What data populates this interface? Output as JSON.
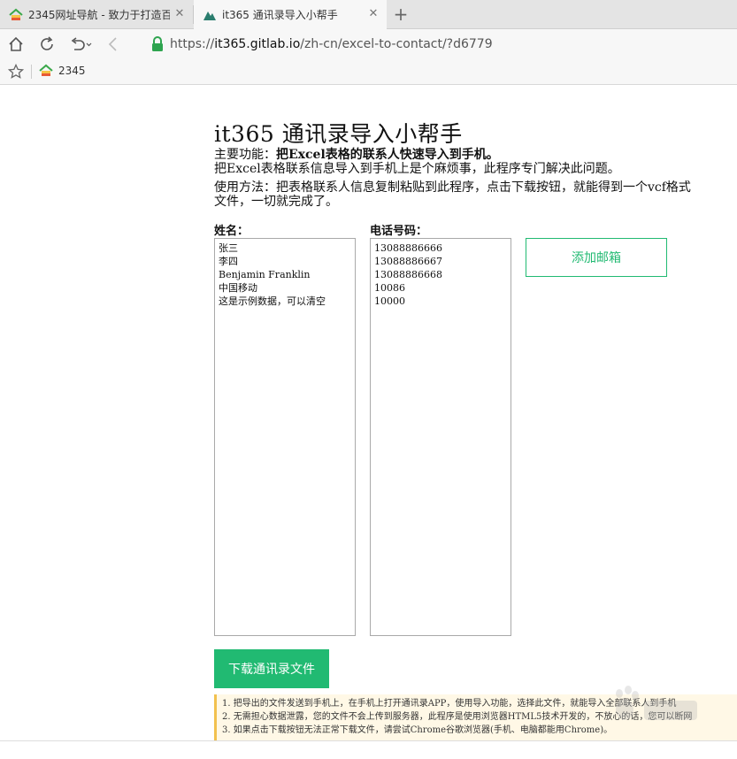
{
  "tabs": [
    {
      "title": "2345网址导航 - 致力于打造百",
      "active": false
    },
    {
      "title": "it365 通讯录导入小帮手",
      "active": true
    }
  ],
  "address": {
    "scheme": "https://",
    "host": "it365.gitlab.io",
    "path": "/zh-cn/excel-to-contact/?d6779"
  },
  "bookmarks": [
    {
      "label": "2345"
    }
  ],
  "page": {
    "title": "it365 通讯录导入小帮手",
    "feature_prefix": "主要功能：",
    "feature_bold": "把Excel表格的联系人快速导入到手机。",
    "description": "把Excel表格联系信息导入到手机上是个麻烦事，此程序专门解决此问题。",
    "usage_line1": "使用方法：把表格联系人信息复制粘贴到此程序，点击下载按钮，就能得到一个vcf格式",
    "usage_line2": "文件，一切就完成了。",
    "name_label": "姓名：",
    "phone_label": "电话号码：",
    "names": [
      "张三",
      "李四",
      "Benjamin Franklin",
      "中国移动",
      "这是示例数据，可以清空"
    ],
    "phones": [
      "13088886666",
      "13088886667",
      "13088886668",
      "10086",
      "10000"
    ],
    "add_email_button": "添加邮箱",
    "download_button": "下载通讯录文件",
    "notes": [
      "1. 把导出的文件发送到手机上，在手机上打开通讯录APP，使用导入功能，选择此文件，就能导入全部联系人到手机",
      "2. 无需担心数据泄露，您的文件不会上传到服务器，此程序是使用浏览器HTML5技术开发的，不放心的话，您可以断网",
      "3. 如果点击下载按钮无法正常下载文件，请尝试Chrome谷歌浏览器(手机、电脑都能用Chrome)。"
    ]
  },
  "colors": {
    "accent": "#21ba72",
    "notes_bg": "#fff8e6",
    "notes_border": "#f2c14e"
  }
}
